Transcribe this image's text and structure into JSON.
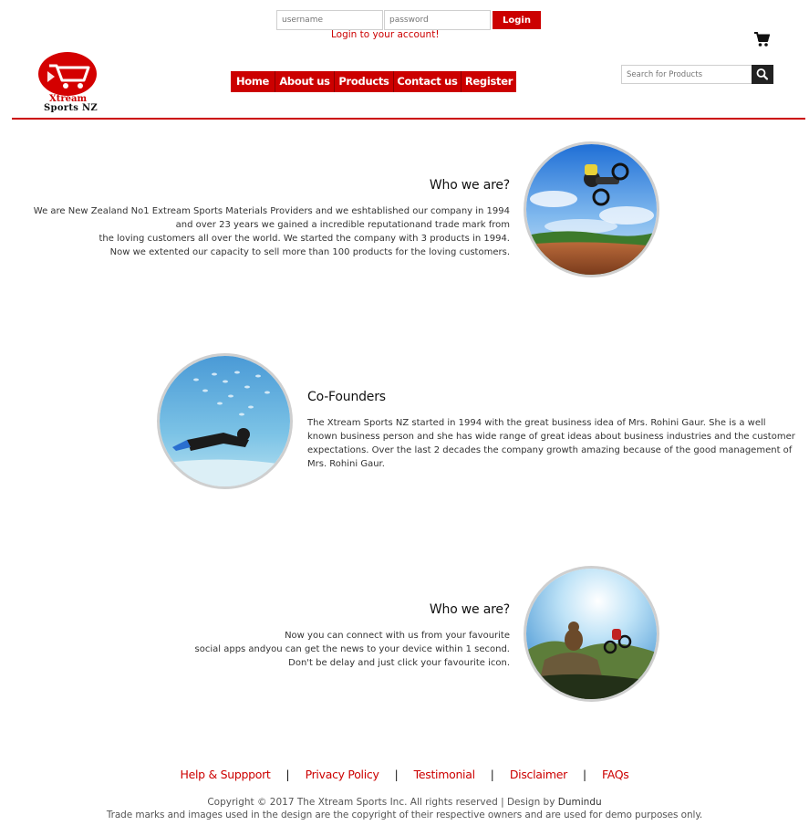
{
  "login": {
    "username_placeholder": "username",
    "password_placeholder": "password",
    "button_label": "Login",
    "message": "Login to your account!"
  },
  "brand": {
    "line1": "Xtream",
    "line2": "Sports NZ",
    "accent_color": "#cc0000"
  },
  "nav": {
    "items": [
      {
        "label": "Home"
      },
      {
        "label": "About us"
      },
      {
        "label": "Products"
      },
      {
        "label": "Contact us"
      },
      {
        "label": "Register"
      }
    ]
  },
  "search": {
    "placeholder": "Search for Products",
    "icon": "search-icon"
  },
  "cart": {
    "icon": "cart-icon"
  },
  "sections": [
    {
      "title": "Who we are?",
      "lines": [
        "We are New Zealand No1 Extream Sports Materials Providers and we eshtablished our company in 1994",
        "and over 23 years we gained a incredible reputationand trade mark from",
        "the loving customers all over the world. We started the company with 3 products in 1994.",
        "Now we extented our capacity to sell more than 100 products for the loving customers."
      ]
    },
    {
      "title": "Co-Founders",
      "lines": [
        "The Xtream Sports NZ started in 1994 with the great business idea of Mrs. Rohini Gaur. She is a well",
        "known business person and she has wide range of great ideas about business industries and the customer",
        "expectations. Over the last 2 decades the company growth amazing because of the good management of",
        "Mrs. Rohini Gaur."
      ]
    },
    {
      "title": "Who we are?",
      "lines": [
        "Now you can connect with us from your favourite",
        "social apps andyou can get the news to your device within 1 second.",
        "Don't be delay and just click your favourite icon."
      ]
    }
  ],
  "footer": {
    "links": [
      {
        "label": "Help & Suppport"
      },
      {
        "label": "Privacy Policy"
      },
      {
        "label": "Testimonial"
      },
      {
        "label": "Disclaimer"
      },
      {
        "label": "FAQs"
      }
    ],
    "separator": "|",
    "copyright_prefix": "Copyright © 2017  The Xtream Sports Inc. All rights reserved | Design by ",
    "copyright_author": "Dumindu",
    "trademark": "Trade marks and images used in the design are the copyright of their respective owners and are used for demo purposes only."
  }
}
